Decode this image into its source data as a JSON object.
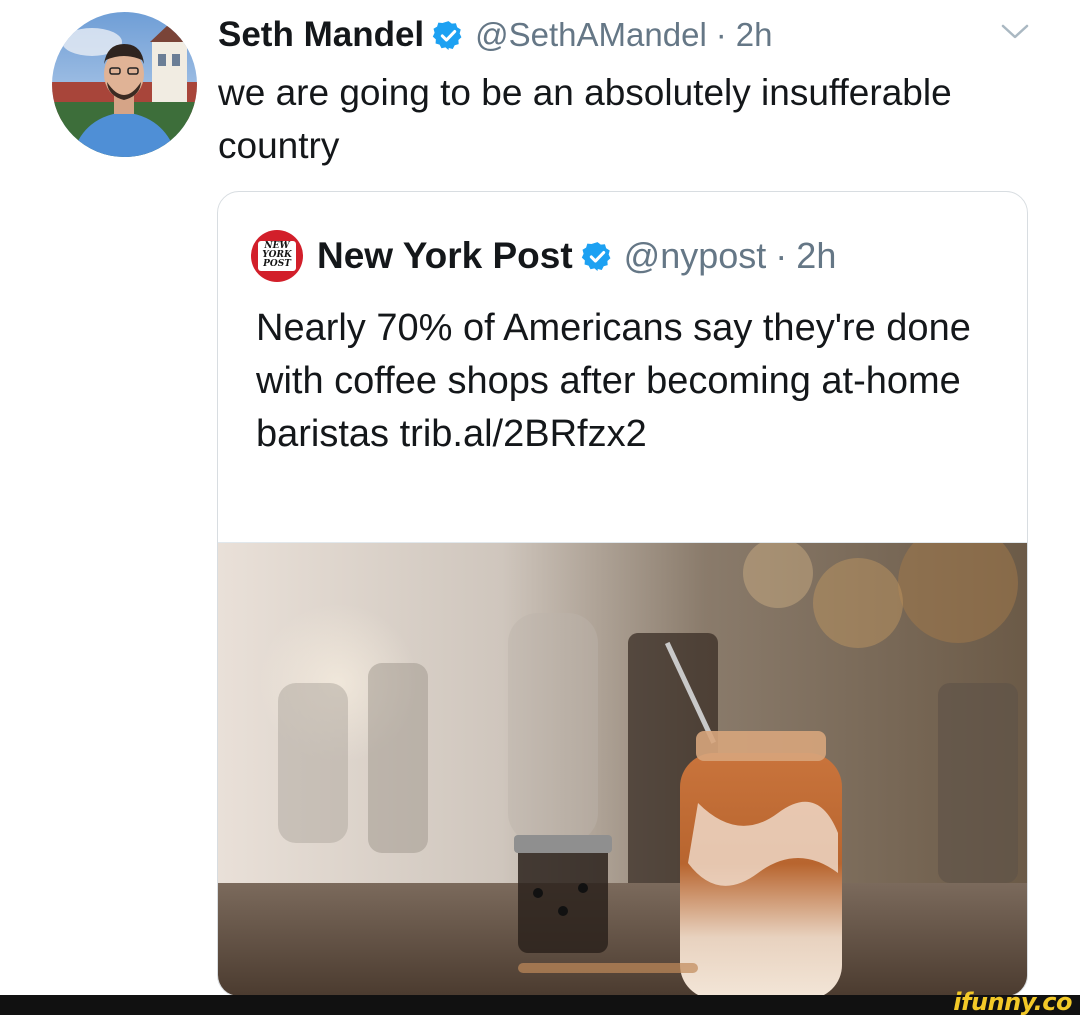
{
  "tweet": {
    "author_name": "Seth Mandel",
    "handle": "@SethAMandel",
    "separator": "·",
    "time": "2h",
    "text": "we are going to be an absolutely insufferable country",
    "verified": true
  },
  "quoted_tweet": {
    "logo_text": "NEW YORK POST",
    "author_name": "New York Post",
    "handle": "@nypost",
    "separator": "·",
    "time": "2h",
    "text": "Nearly 70% of Americans say they're done with coffee shops after becoming at-home baristas trib.al/2BRfzx2",
    "verified": true
  },
  "watermark": {
    "text": "ifunny.co"
  },
  "icons": [
    "verified-badge-icon",
    "caret-down-icon"
  ],
  "colors": {
    "verified_blue": "#1da1f2",
    "secondary_text": "#657786",
    "nypost_red": "#d21f2a",
    "watermark_yellow": "#f3c928"
  }
}
